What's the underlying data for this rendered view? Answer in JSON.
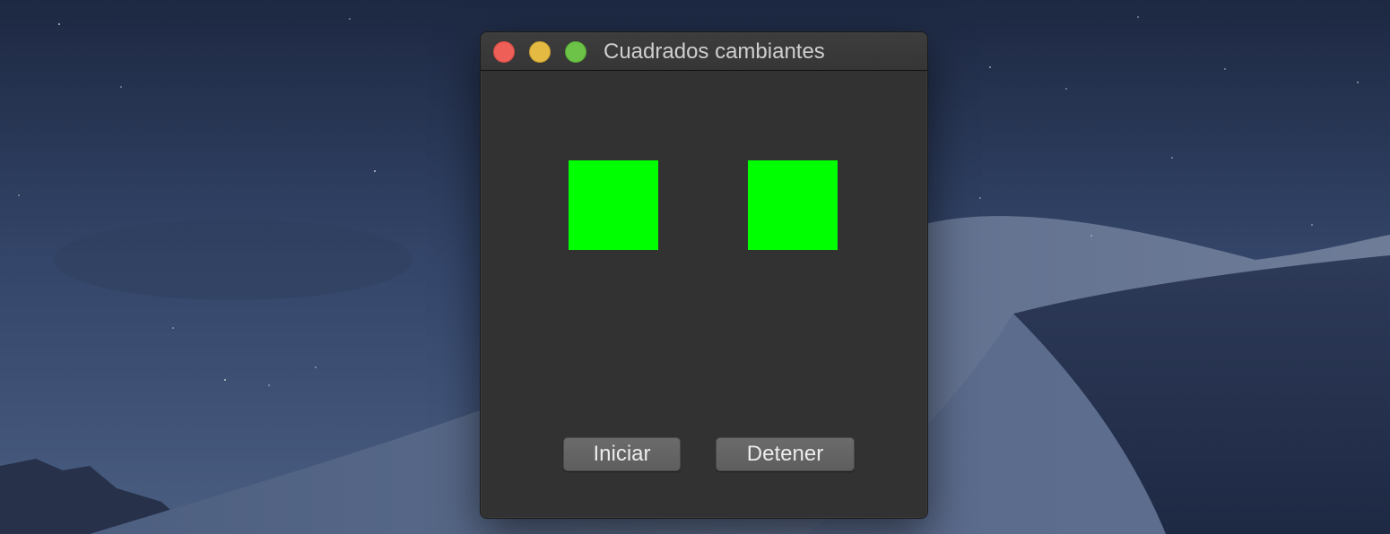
{
  "window": {
    "title": "Cuadrados cambiantes"
  },
  "squares": [
    {
      "color": "#00ff00"
    },
    {
      "color": "#00ff00"
    }
  ],
  "buttons": {
    "start_label": "Iniciar",
    "stop_label": "Detener"
  },
  "traffic_lights": {
    "close": "close-icon",
    "minimize": "minimize-icon",
    "zoom": "zoom-icon"
  }
}
